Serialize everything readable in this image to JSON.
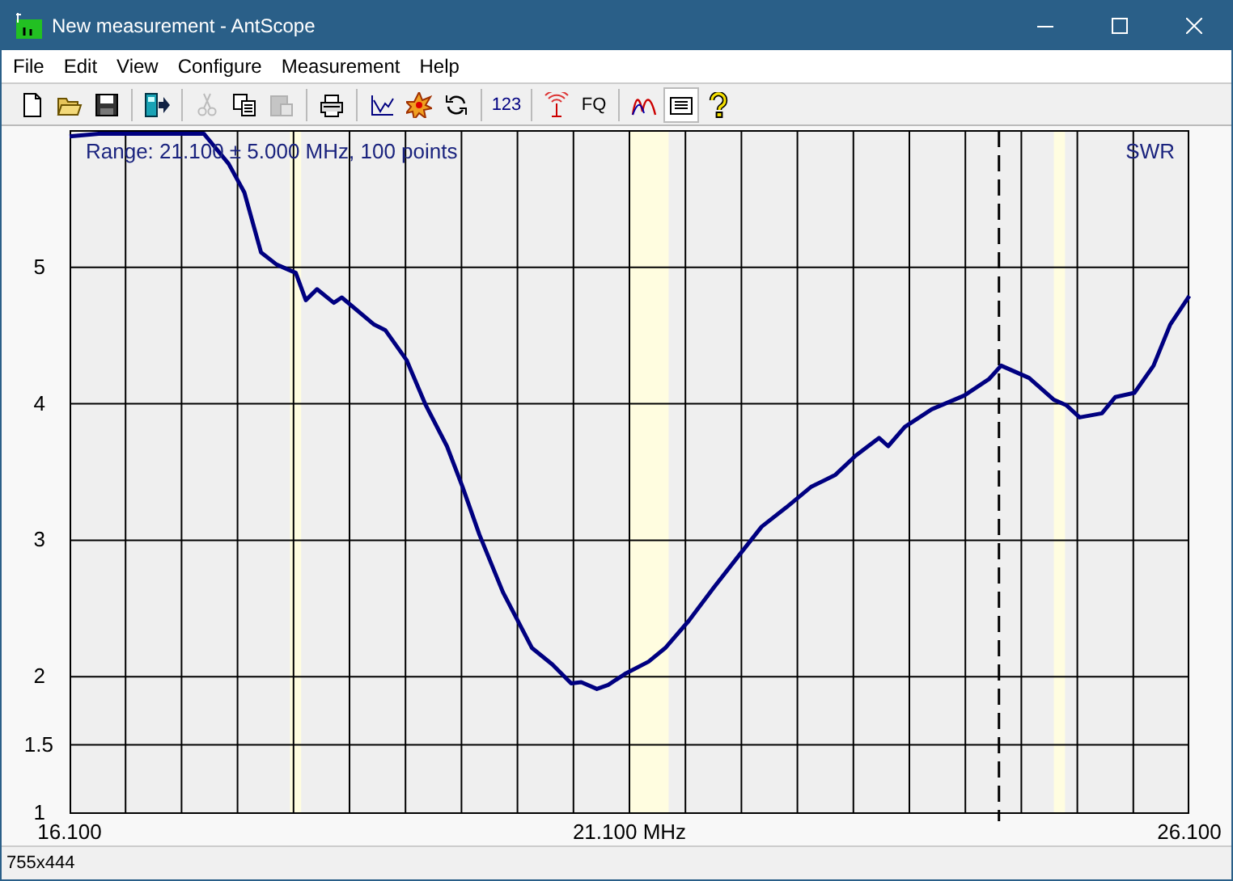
{
  "window": {
    "title": "New measurement - AntScope"
  },
  "menu": [
    "File",
    "Edit",
    "View",
    "Configure",
    "Measurement",
    "Help"
  ],
  "toolbar": [
    {
      "kind": "new",
      "disabled": false,
      "selected": false
    },
    {
      "kind": "open",
      "disabled": false,
      "selected": false
    },
    {
      "kind": "save",
      "disabled": false,
      "selected": false
    },
    {
      "kind": "separator"
    },
    {
      "kind": "device",
      "disabled": false,
      "selected": false
    },
    {
      "kind": "separator"
    },
    {
      "kind": "cut",
      "disabled": true,
      "selected": false
    },
    {
      "kind": "copy",
      "disabled": false,
      "selected": false
    },
    {
      "kind": "paste",
      "disabled": true,
      "selected": false
    },
    {
      "kind": "separator"
    },
    {
      "kind": "print",
      "disabled": false,
      "selected": false
    },
    {
      "kind": "separator"
    },
    {
      "kind": "chart",
      "disabled": false,
      "selected": false
    },
    {
      "kind": "burst",
      "disabled": false,
      "selected": false
    },
    {
      "kind": "refresh",
      "disabled": false,
      "selected": false
    },
    {
      "kind": "separator"
    },
    {
      "kind": "text",
      "label": "123",
      "disabled": false,
      "selected": false
    },
    {
      "kind": "separator"
    },
    {
      "kind": "antenna",
      "disabled": false,
      "selected": false
    },
    {
      "kind": "text",
      "label": "FQ",
      "disabled": false,
      "selected": false
    },
    {
      "kind": "separator"
    },
    {
      "kind": "curves",
      "disabled": false,
      "selected": false
    },
    {
      "kind": "list",
      "disabled": false,
      "selected": true
    },
    {
      "kind": "help",
      "disabled": false,
      "selected": false
    }
  ],
  "chart": {
    "chart_data": {
      "type": "line",
      "xlim": [
        16.1,
        26.1
      ],
      "ylim": [
        1,
        6
      ],
      "xticks": [
        {
          "value": 16.1,
          "label": "16.100"
        },
        {
          "value": 21.1,
          "label": "21.100 MHz"
        },
        {
          "value": 26.1,
          "label": "26.100"
        }
      ],
      "yticks": [
        1,
        1.5,
        2,
        3,
        4,
        5
      ],
      "x": [
        16.1,
        16.36,
        17.3,
        17.52,
        17.66,
        17.81,
        17.95,
        18.12,
        18.21,
        18.31,
        18.46,
        18.53,
        18.82,
        18.92,
        19.11,
        19.28,
        19.47,
        19.61,
        19.76,
        19.97,
        20.23,
        20.41,
        20.58,
        20.67,
        20.81,
        20.91,
        21.06,
        21.27,
        21.42,
        21.63,
        21.85,
        22.07,
        22.28,
        22.5,
        22.72,
        22.94,
        23.12,
        23.33,
        23.41,
        23.56,
        23.8,
        24.09,
        24.31,
        24.42,
        24.67,
        24.89,
        25.0,
        25.12,
        25.32,
        25.44,
        25.61,
        25.78,
        25.93,
        26.1
      ],
      "series": [
        {
          "name": "SWR",
          "color": "#000080",
          "values": [
            5.96,
            5.98,
            5.98,
            5.76,
            5.55,
            5.11,
            5.02,
            4.96,
            4.76,
            4.84,
            4.74,
            4.78,
            4.58,
            4.54,
            4.32,
            3.99,
            3.69,
            3.39,
            3.04,
            2.62,
            2.21,
            2.09,
            1.95,
            1.96,
            1.91,
            1.94,
            2.02,
            2.11,
            2.21,
            2.41,
            2.65,
            2.88,
            3.1,
            3.24,
            3.39,
            3.48,
            3.62,
            3.75,
            3.69,
            3.83,
            3.96,
            4.06,
            4.18,
            4.28,
            4.19,
            4.03,
            3.99,
            3.9,
            3.93,
            4.05,
            4.08,
            4.28,
            4.58,
            4.79
          ]
        }
      ],
      "grid": true,
      "annotations": [
        {
          "text": "Range: 21.100 ± 5.000 MHz, 100 points"
        }
      ],
      "bands": [
        {
          "axis": "x",
          "from": 18.068,
          "to": 18.168
        },
        {
          "axis": "x",
          "from": 21.1,
          "to": 21.45
        },
        {
          "axis": "x",
          "from": 24.89,
          "to": 24.99
        }
      ],
      "ref_lines": [
        {
          "axis": "x",
          "value": 24.4
        }
      ]
    }
  },
  "status_bar": "755x444"
}
